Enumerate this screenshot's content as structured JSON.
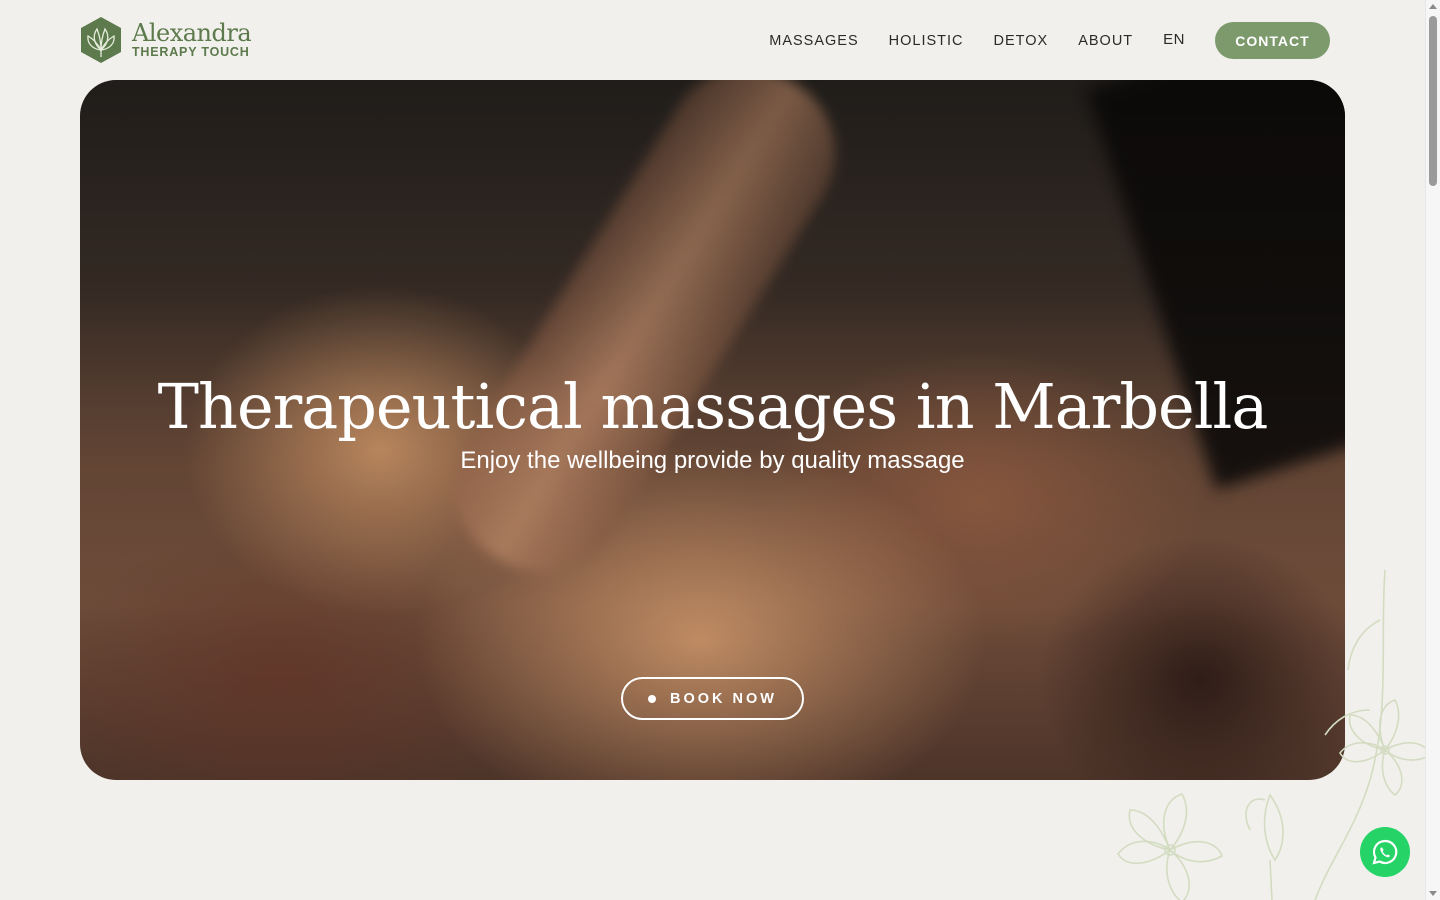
{
  "brand": {
    "name": "Alexandra",
    "tagline": "THERAPY TOUCH",
    "logo_icon": "lotus-hexagon-icon",
    "color": "#5c7a4c"
  },
  "nav": {
    "items": [
      {
        "label": "MASSAGES"
      },
      {
        "label": "HOLISTIC"
      },
      {
        "label": "DETOX"
      },
      {
        "label": "ABOUT"
      }
    ],
    "language": "EN",
    "contact_label": "CONTACT",
    "contact_color": "#7c9a6c"
  },
  "hero": {
    "title": "Therapeutical massages in Marbella",
    "subtitle": "Enjoy the wellbeing provide by quality massage",
    "book_label": "BOOK NOW"
  },
  "floating": {
    "whatsapp_icon": "whatsapp-icon",
    "whatsapp_color": "#25d366"
  },
  "colors": {
    "page_bg": "#f1f0ec",
    "floral": "#d3dcc1"
  }
}
